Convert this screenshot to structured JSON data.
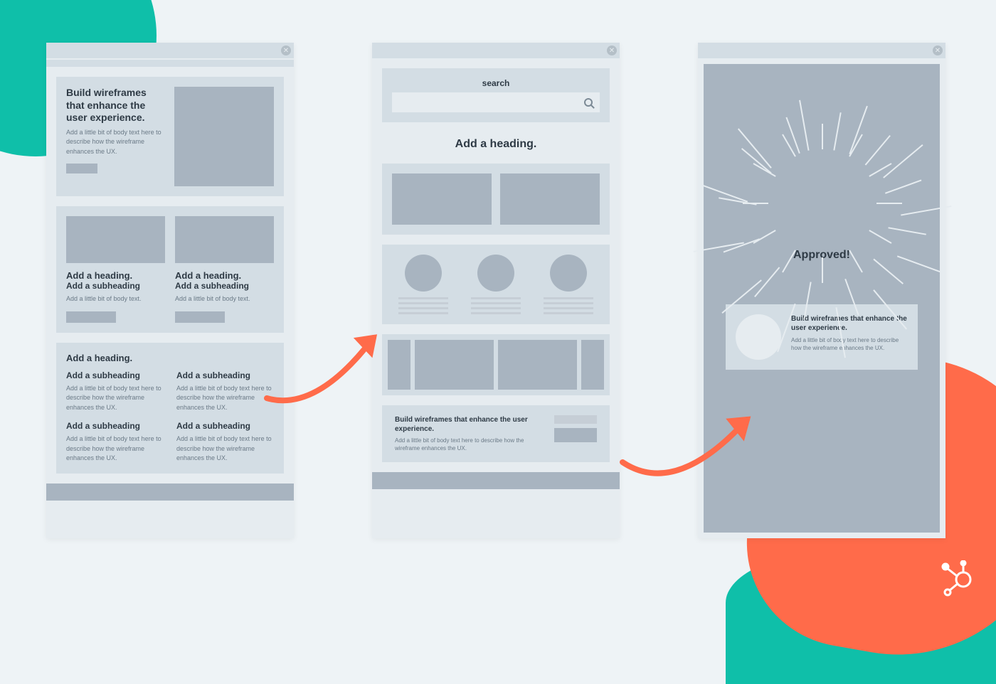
{
  "hero": {
    "title": "Build wireframes that enhance the user experience.",
    "body": "Add a little bit of body text here to describe how the wireframe enhances the UX."
  },
  "card_pair": {
    "heading": "Add a heading.",
    "subheading": "Add a subheading",
    "body": "Add a little bit of body text."
  },
  "section": {
    "heading": "Add a heading.",
    "sub": "Add a subheading",
    "body": "Add a little bit of body text here to describe how the wireframe enhances the UX."
  },
  "mock2": {
    "search_label": "search",
    "heading": "Add a heading.",
    "cta_title": "Build wireframes that enhance the user experience.",
    "cta_body": "Add a little bit of body text here to describe how the wireframe  enhances the UX."
  },
  "mock3": {
    "approved": "Approved!",
    "card_title": "Build wireframes that enhance the user experience.",
    "card_body": "Add a little bit of body text here to describe how the wireframe enhances the UX."
  }
}
